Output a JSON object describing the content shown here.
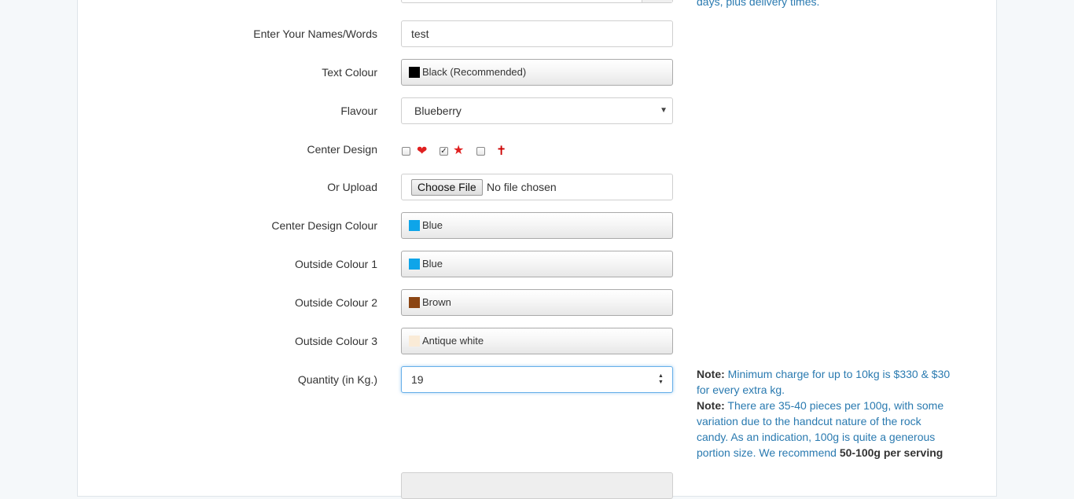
{
  "delivery_fragment": "days, plus delivery times.",
  "fields": {
    "names": {
      "label": "Enter Your Names/Words",
      "value": "test"
    },
    "text_colour": {
      "label": "Text Colour",
      "value": "Black (Recommended)",
      "swatch": "#000000"
    },
    "flavour": {
      "label": "Flavour",
      "value": "Blueberry"
    },
    "center_design": {
      "label": "Center Design",
      "options": [
        {
          "icon": "heart-icon",
          "glyph": "❤",
          "checked": false
        },
        {
          "icon": "star-icon",
          "glyph": "★",
          "checked": true
        },
        {
          "icon": "cross-icon",
          "glyph": "✝",
          "checked": false
        }
      ]
    },
    "upload": {
      "label": "Or Upload",
      "button": "Choose File",
      "status": "No file chosen"
    },
    "center_design_colour": {
      "label": "Center Design Colour",
      "value": "Blue",
      "swatch": "#0ea5e9"
    },
    "outside_colour_1": {
      "label": "Outside Colour 1",
      "value": "Blue",
      "swatch": "#0ea5e9"
    },
    "outside_colour_2": {
      "label": "Outside Colour 2",
      "value": "Brown",
      "swatch": "#8b4513"
    },
    "outside_colour_3": {
      "label": "Outside Colour 3",
      "value": "Antique white",
      "swatch": "#faebd7"
    },
    "quantity": {
      "label": "Quantity (in Kg.)",
      "value": "19"
    }
  },
  "notes": {
    "note1_prefix": "Note:",
    "note1_line1": "Minimum charge for up to 10kg is $330 & $30",
    "note1_line2": "for every extra kg.",
    "note2_prefix": "Note:",
    "note2_line1": "There are 35-40 pieces per 100g, with some",
    "note2_line2": "variation due to the handcut nature of the rock",
    "note2_line3": "candy. As an indication, 100g is quite a generous",
    "note2_line4": "portion size. We recommend",
    "note2_bold": "50-100g per serving"
  },
  "colors": {
    "link_blue": "#2a7ab0",
    "focus_border": "#66afe9"
  }
}
